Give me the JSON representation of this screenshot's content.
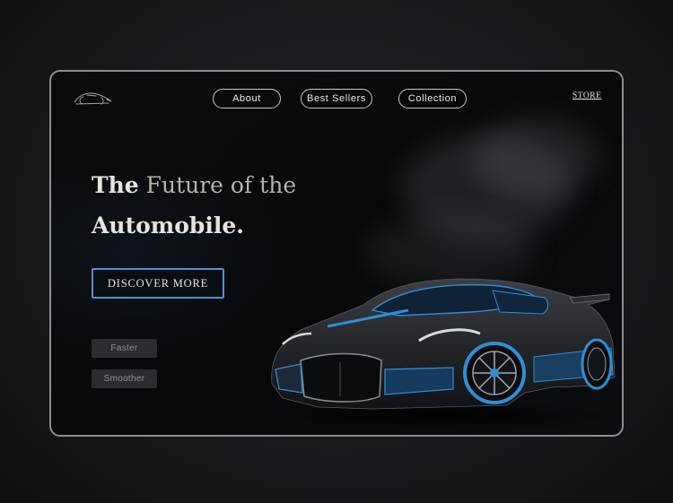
{
  "nav": {
    "about": "About",
    "best_sellers": "Best Sellers",
    "collection": "Collection",
    "store": "STORE"
  },
  "hero": {
    "title_word1": "The",
    "title_rest": "Future of the",
    "title_word3": "Automobile.",
    "cta": "DISCOVER MORE"
  },
  "tags": {
    "faster": "Faster",
    "smoother": "Smoother"
  },
  "brand": {
    "logo_icon": "car-outline-icon"
  },
  "colors": {
    "accent": "#4f8fd6",
    "background": "#08090b",
    "car_accent": "#2e8fd6"
  }
}
